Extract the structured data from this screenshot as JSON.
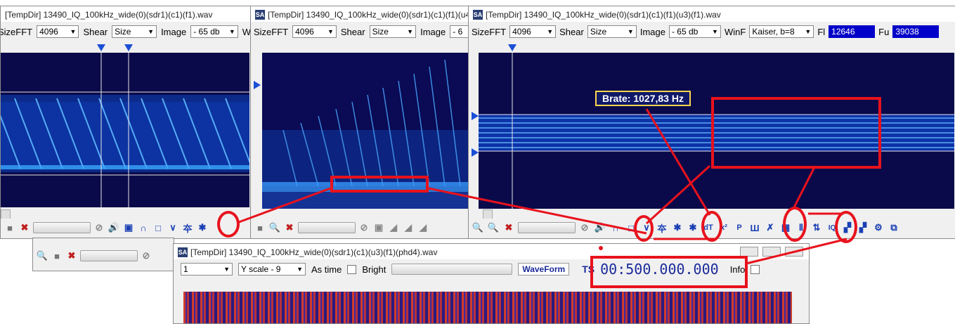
{
  "windows": {
    "w1": {
      "title": "[TempDir] 13490_IQ_100kHz_wide(0)(sdr1)(c1)(f1).wav",
      "size_fft_label": "SizeFFT",
      "size_fft_value": "4096",
      "shear_label": "Shear",
      "shear_value": "Size",
      "image_label": "Image",
      "image_value": "- 65 db",
      "extra_label": "W"
    },
    "w2": {
      "title": "[TempDir] 13490_IQ_100kHz_wide(0)(sdr1)(c1)(f1)(u4",
      "size_fft_label": "SizeFFT",
      "size_fft_value": "4096",
      "shear_label": "Shear",
      "shear_value": "Size",
      "image_label": "Image",
      "image_value": "- 6"
    },
    "w3": {
      "title": "[TempDir] 13490_IQ_100kHz_wide(0)(sdr1)(c1)(f1)(u3)(f1).wav",
      "size_fft_label": "SizeFFT",
      "size_fft_value": "4096",
      "shear_label": "Shear",
      "shear_value": "Size",
      "image_label": "Image",
      "image_value": "- 65 db",
      "winf_label": "WinF",
      "winf_value": "Kaiser, b=8",
      "fl_label": "Fl",
      "fl_value": "12646",
      "fu_label": "Fu",
      "fu_value": "39038",
      "tooltip": "Brate: 1027,83 Hz"
    },
    "w4": {
      "title": "[TempDir] 13490_IQ_100kHz_wide(0)(sdr1)(c1)(u3)(f1)(phd4).wav",
      "channel_value": "1",
      "yscale_value": "Y scale - 9",
      "as_time_label": "As time",
      "bright_label": "Bright",
      "waveform_label": "WaveForm",
      "ts_label": "TS",
      "ts_value": "00:500.000.000",
      "info_label": "Info"
    }
  },
  "icons": {
    "zoom_in": "🔍",
    "zoom_out": "🔍",
    "clear": "✖",
    "prohibit": "⊘",
    "speaker": "🔊",
    "square": "▣",
    "arc": "∩",
    "rect": "□",
    "v": "∨",
    "up_sym": "夲",
    "down_sym": "✱",
    "dt": "dT",
    "x2": "x²",
    "p": "P",
    "bars": "Ш",
    "cross": "✗",
    "grid": "▦",
    "pulse": "Ⅱ",
    "iq": "IQ",
    "pattern": "▞",
    "gear": "⚙",
    "copy": "⧉"
  },
  "colors": {
    "annotation_red": "#e8121c",
    "spectrum_bg": "#0a0a4a",
    "value_box": "#0000c8"
  }
}
